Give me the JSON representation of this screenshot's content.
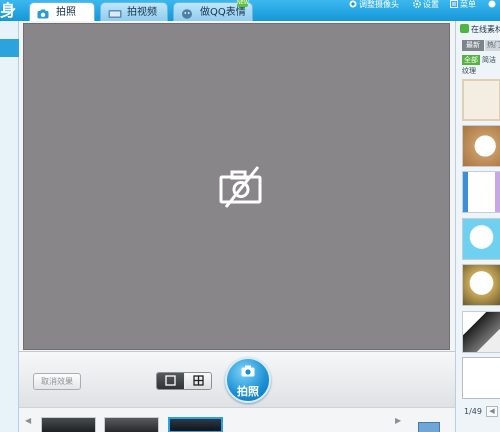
{
  "app": {
    "logo_char": "身"
  },
  "tabs": [
    {
      "label": "拍照",
      "icon": "camera-icon",
      "active": true
    },
    {
      "label": "拍视频",
      "icon": "video-icon",
      "active": false
    },
    {
      "label": "做QQ表情",
      "icon": "emoticon-icon",
      "active": false,
      "badge": "NEW"
    }
  ],
  "top_actions": {
    "adjust_camera": "调整摄像头",
    "settings": "设置",
    "menu": "菜单"
  },
  "controls": {
    "cancel_effect": "取消效果",
    "shutter_label": "拍照"
  },
  "right_panel": {
    "online_materials": "在线素材",
    "subtab_newest": "最新",
    "subtab_more": "热门",
    "cat_all": "全部",
    "cat_simple": "简洁",
    "cat_texture": "纹理",
    "page_indicator": "1/49"
  },
  "colors": {
    "brand": "#1aa1e0",
    "preview_bg": "#888689",
    "accent_green": "#56b340"
  }
}
